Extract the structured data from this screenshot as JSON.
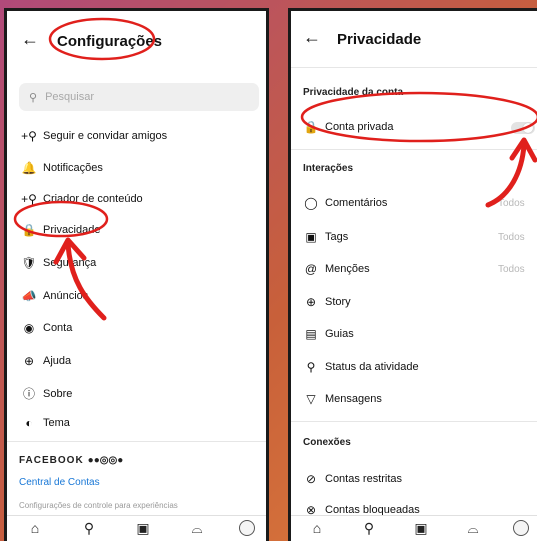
{
  "left": {
    "title": "Configurações",
    "search_placeholder": "Pesquisar",
    "items": [
      {
        "icon": "follow-icon",
        "glyph": "+⚲",
        "label": "Seguir e convidar amigos"
      },
      {
        "icon": "bell-icon",
        "glyph": "🔔",
        "label": "Notificações"
      },
      {
        "icon": "creator-icon",
        "glyph": "+⚲",
        "label": "Criador de conteúdo"
      },
      {
        "icon": "lock-icon",
        "glyph": "🔒",
        "label": "Privacidade"
      },
      {
        "icon": "shield-icon",
        "glyph": "🛡",
        "label": "Segurança"
      },
      {
        "icon": "megaphone-icon",
        "glyph": "📣",
        "label": "Anúncios"
      },
      {
        "icon": "account-icon",
        "glyph": "◉",
        "label": "Conta"
      },
      {
        "icon": "help-icon",
        "glyph": "⊕",
        "label": "Ajuda"
      },
      {
        "icon": "info-icon",
        "glyph": "ⓘ",
        "label": "Sobre"
      },
      {
        "icon": "theme-icon",
        "glyph": "◐",
        "label": "Tema"
      }
    ],
    "facebook": "FACEBOOK",
    "facebook_dots": "●●◎◎●",
    "accounts_center": "Central de Contas",
    "accounts_note": "Configurações de controle para experiências"
  },
  "right": {
    "title": "Privacidade",
    "account_privacy_header": "Privacidade da conta",
    "private_account": "Conta privada",
    "private_account_enabled": false,
    "interactions_header": "Interações",
    "interactions": [
      {
        "icon": "comment-icon",
        "glyph": "◯",
        "label": "Comentários",
        "value": "Todos"
      },
      {
        "icon": "tag-icon",
        "glyph": "▣",
        "label": "Tags",
        "value": "Todos"
      },
      {
        "icon": "mention-icon",
        "glyph": "@",
        "label": "Menções",
        "value": "Todos"
      },
      {
        "icon": "story-icon",
        "glyph": "⊕",
        "label": "Story",
        "value": ""
      },
      {
        "icon": "guides-icon",
        "glyph": "▤",
        "label": "Guias",
        "value": ""
      },
      {
        "icon": "activity-icon",
        "glyph": "⚲",
        "label": "Status da atividade",
        "value": ""
      },
      {
        "icon": "message-icon",
        "glyph": "▽",
        "label": "Mensagens",
        "value": ""
      }
    ],
    "connections_header": "Conexões",
    "connections": [
      {
        "icon": "restricted-icon",
        "glyph": "⊘",
        "label": "Contas restritas"
      },
      {
        "icon": "blocked-icon",
        "glyph": "⊗",
        "label": "Contas bloqueadas"
      }
    ]
  },
  "tabbar": [
    "home-icon",
    "search-icon",
    "reels-icon",
    "shop-icon",
    "profile-icon"
  ],
  "tab_glyphs": [
    "⌂",
    "⚲",
    "▣",
    "⌓",
    ""
  ],
  "colors": {
    "annotation": "#e0201c",
    "link": "#1877d6"
  }
}
